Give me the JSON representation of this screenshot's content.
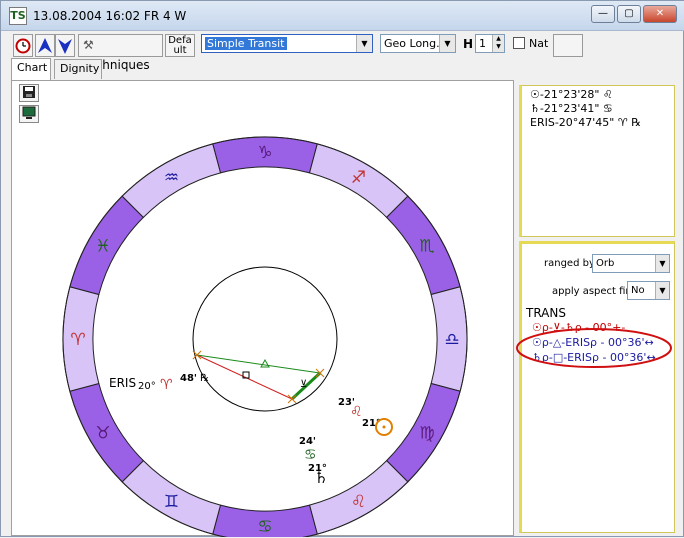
{
  "window": {
    "app_icon": "TS",
    "title": "13.08.2004  16:02 FR  4 W",
    "minimize": "—",
    "maximize": "▢",
    "close": "✕"
  },
  "toolbar": {
    "techniques_label": "Techniques",
    "default_label": "Defa\nult",
    "chart_type": "Simple Transit",
    "coord": "Geo Long.",
    "h_label": "H",
    "h_value": "1",
    "nat_label": "Nat"
  },
  "tabs": [
    "Chart",
    "Dignity"
  ],
  "positions": [
    {
      "glyph": "☉",
      "text": "-21°23'28\" ♌"
    },
    {
      "glyph": "♄",
      "text": "-21°23'41\" ♋"
    },
    {
      "glyph": "",
      "text": "ERIS-20°47'45\" ♈ ℞"
    }
  ],
  "aspects_panel": {
    "ranged_by_label": "ranged by",
    "ranged_by_value": "Orb",
    "apply_first_label": "apply aspect first",
    "apply_first_value": "No",
    "header": "TRANS",
    "lines": [
      "☉ρ-⊻-♄ρ - 00°+-",
      "☉ρ-△-ERISρ - 00°36'↔",
      "♄ρ-□-ERISρ - 00°36'↔"
    ],
    "line_colors": [
      "#c00000",
      "#1a1aa0",
      "#1a1aa0"
    ]
  },
  "chart": {
    "signs": [
      "♑",
      "♐",
      "♏",
      "♎",
      "♍",
      "♌",
      "♋",
      "♊",
      "♉",
      "♈",
      "♓",
      "♒"
    ],
    "sign_colors": [
      "#5a1a7a",
      "#c03030",
      "#206020",
      "#1a1aa0",
      "#5a1a7a",
      "#c03030",
      "#206020",
      "#1a1aa0",
      "#5a1a7a",
      "#c03030",
      "#206020",
      "#1a1aa0"
    ],
    "eris_label": "ERIS",
    "eris_deg": "20°",
    "eris_sign": "♈",
    "eris_min": "48'",
    "eris_retro": "℞",
    "sun_min": "23'",
    "sun_sign": "♌",
    "sun_deg": "21°",
    "sun_glyph": "☉",
    "sat_min": "24'",
    "sat_sign": "♋",
    "sat_deg": "21°",
    "sat_glyph": "♄"
  },
  "colors": {
    "accent_purple": "#9a60e6",
    "light_purple": "#d8c4f6",
    "annotation_red": "#d01010"
  }
}
